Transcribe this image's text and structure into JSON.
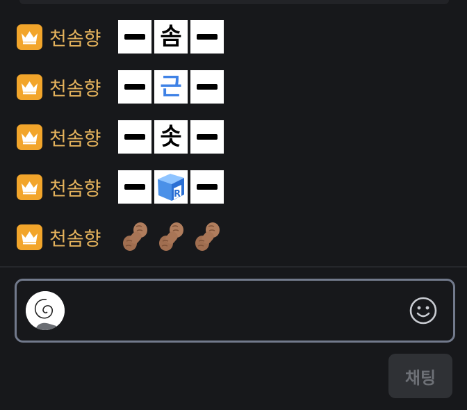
{
  "chat": {
    "messages": [
      {
        "nickname": "천솜향",
        "emotes": [
          "-",
          "솜",
          "-"
        ]
      },
      {
        "nickname": "천솜향",
        "emotes": [
          "-",
          "근",
          "-"
        ]
      },
      {
        "nickname": "천솜향",
        "emotes": [
          "-",
          "솟",
          "-"
        ]
      },
      {
        "nickname": "천솜향",
        "emotes": [
          "-",
          "cube",
          "-"
        ]
      },
      {
        "nickname": "천솜향",
        "emotes": [
          "peanut",
          "peanut",
          "peanut"
        ]
      }
    ]
  },
  "badge": {
    "icon": "crown-icon",
    "color": "#f2a52b"
  },
  "input": {
    "placeholder": "",
    "value": ""
  },
  "send": {
    "label": "채팅"
  },
  "icons": {
    "emoji": "smiley-icon",
    "avatar": "swirl-avatar"
  },
  "colors": {
    "nickname": "#e4b25c",
    "background": "#17181b",
    "input_border": "#727a8c",
    "accent_blue": "#3f82e6"
  }
}
